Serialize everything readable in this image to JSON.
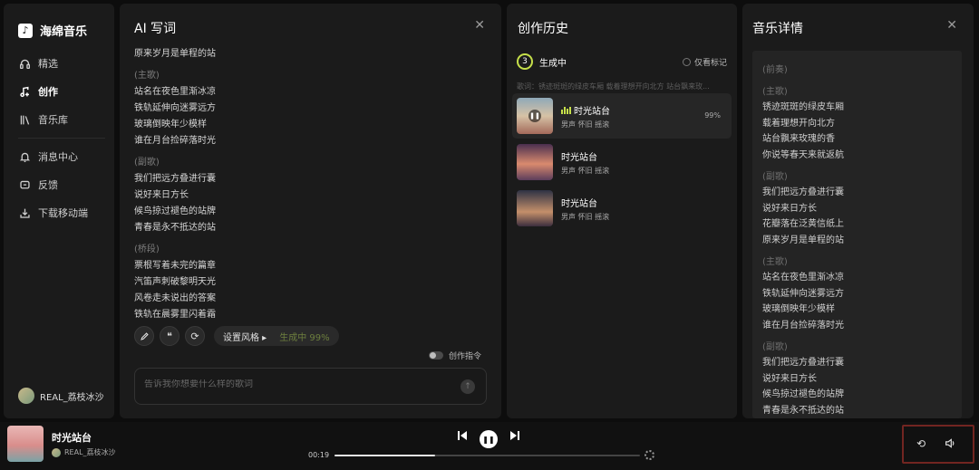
{
  "app": {
    "name": "海绵音乐"
  },
  "sidebar": {
    "items": [
      {
        "label": "精选",
        "icon": "headphones-icon"
      },
      {
        "label": "创作",
        "icon": "music-note-plus-icon",
        "active": true
      },
      {
        "label": "音乐库",
        "icon": "library-icon"
      },
      {
        "label": "消息中心",
        "icon": "bell-icon"
      },
      {
        "label": "反馈",
        "icon": "feedback-icon"
      },
      {
        "label": "下载移动端",
        "icon": "download-icon"
      }
    ],
    "user": {
      "name": "REAL_荔枝冰沙"
    }
  },
  "ai_panel": {
    "title": "AI 写词",
    "lyrics": [
      {
        "text": "原来岁月是单程的站"
      },
      {
        "text": "(主歌)",
        "section": true
      },
      {
        "text": "站名在夜色里渐冰凉"
      },
      {
        "text": "铁轨延伸向迷雾远方"
      },
      {
        "text": "玻璃倒映年少模样"
      },
      {
        "text": "谁在月台捡碎落时光"
      },
      {
        "text": "(副歌)",
        "section": true
      },
      {
        "text": "我们把远方叠进行囊"
      },
      {
        "text": "说好来日方长"
      },
      {
        "text": "候鸟掠过褪色的站牌"
      },
      {
        "text": "青春是永不抵达的站"
      },
      {
        "text": "(桥段)",
        "section": true
      },
      {
        "text": "票根写着未完的篇章"
      },
      {
        "text": "汽笛声刺破黎明天光"
      },
      {
        "text": "风卷走未说出的答案"
      },
      {
        "text": "铁轨在晨雾里闪着霜"
      }
    ],
    "style_label": "设置风格",
    "generating": "生成中 99%",
    "toggle_label": "创作指令",
    "input_placeholder": "告诉我你想要什么样的歌词"
  },
  "history": {
    "title": "创作历史",
    "count": "3",
    "status": "生成中",
    "only_marked": "仅看标记",
    "prompt_preview": "歌词：锈迹斑斑的绿皮车厢 载着理想开向北方 站台飘来玫...",
    "songs": [
      {
        "title": "时光站台",
        "tags": "男声 怀旧 摇滚",
        "progress": "99%",
        "active": true
      },
      {
        "title": "时光站台",
        "tags": "男声 怀旧 摇滚"
      },
      {
        "title": "时光站台",
        "tags": "男声 怀旧 摇滚"
      }
    ]
  },
  "details": {
    "title": "音乐详情",
    "lyrics": [
      {
        "text": "(前奏)",
        "section": true
      },
      {
        "text": "(主歌)",
        "section": true,
        "gap": true
      },
      {
        "text": "锈迹斑斑的绿皮车厢"
      },
      {
        "text": "载着理想开向北方"
      },
      {
        "text": "站台飘来玫瑰的香"
      },
      {
        "text": "你说等春天来就返航"
      },
      {
        "text": "(副歌)",
        "section": true,
        "gap": true
      },
      {
        "text": "我们把远方叠进行囊"
      },
      {
        "text": "说好来日方长"
      },
      {
        "text": "花瓣落在泛黄信纸上"
      },
      {
        "text": "原来岁月是单程的站"
      },
      {
        "text": "(主歌)",
        "section": true,
        "gap": true
      },
      {
        "text": "站名在夜色里渐冰凉"
      },
      {
        "text": "铁轨延伸向迷雾远方"
      },
      {
        "text": "玻璃倒映年少模样"
      },
      {
        "text": "谁在月台捡碎落时光"
      },
      {
        "text": "(副歌)",
        "section": true,
        "gap": true
      },
      {
        "text": "我们把远方叠进行囊"
      },
      {
        "text": "说好来日方长"
      },
      {
        "text": "候鸟掠过褪色的站牌"
      },
      {
        "text": "青春是永不抵达的站"
      }
    ]
  },
  "player": {
    "title": "时光站台",
    "user": "REAL_荔枝冰沙",
    "time": "00:19",
    "progress": 0.33
  }
}
